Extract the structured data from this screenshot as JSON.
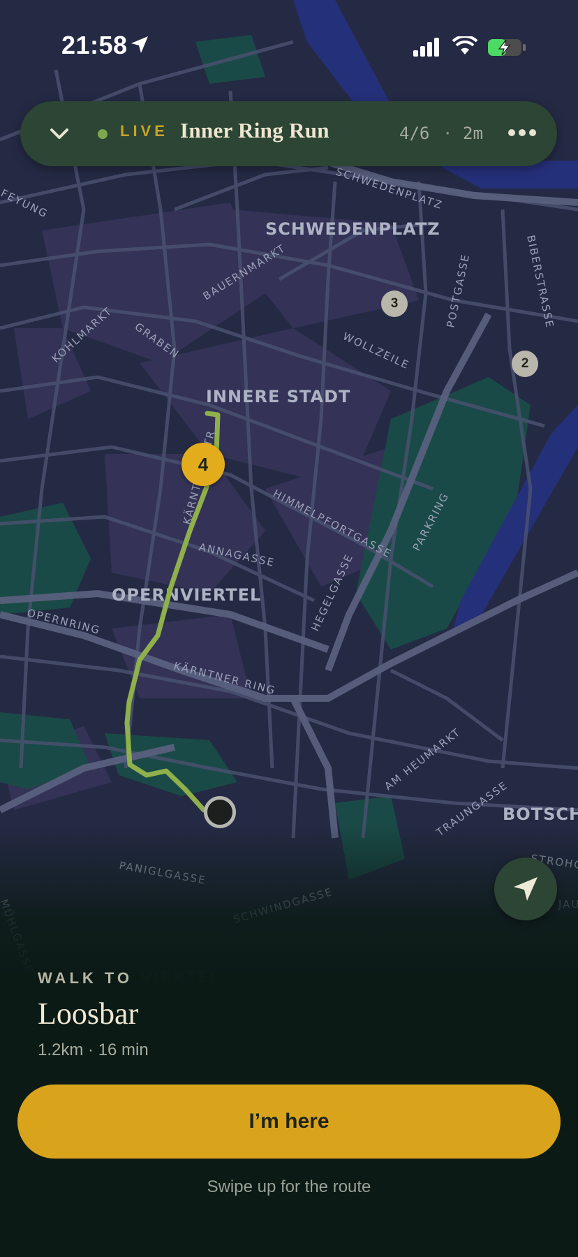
{
  "status_bar": {
    "time": "21:58",
    "icons": [
      "location-arrow-icon",
      "signal-icon",
      "wifi-icon",
      "battery-charging-icon"
    ]
  },
  "top_bar": {
    "collapse_icon": "chevron-down-icon",
    "live_label": "LIVE",
    "title": "Inner Ring Run",
    "progress": "4/6",
    "separator": "·",
    "elapsed": "2m",
    "more_icon": "more-dots-icon"
  },
  "map": {
    "districts": [
      "SCHWEDENPLATZ",
      "INNERE STADT",
      "OPERNVIERTEL",
      "BOTSCHA",
      "VIERTEL"
    ],
    "streets": [
      "SCHWEDENPLATZ",
      "BAUERNMARKT",
      "KOHLMARKT",
      "GRABEN",
      "WOLLZEILE",
      "POSTGASSE",
      "BIBERSTRASSE",
      "KÄRNTNER STRASSE",
      "HIMMELPFORTGASSE",
      "ANNAGASSE",
      "HEGELGASSE",
      "PARKRING",
      "OPERNRING",
      "KÄRNTNER RING",
      "AM HEUMARKT",
      "TRAUNGASSE",
      "PANIGLGASSE",
      "SCHWINDGASSE",
      "MÜHLGASSE",
      "FEYUNG",
      "STROHGASSE",
      "JAU"
    ],
    "stop_markers": [
      {
        "label": "4",
        "state": "current"
      },
      {
        "label": "3",
        "state": "done"
      },
      {
        "label": "2",
        "state": "done"
      }
    ],
    "colors": {
      "route": "#8fb04a",
      "current_stop": "#e2ac1c",
      "park": "#1a4a47",
      "water": "#25307a"
    },
    "locate_icon": "navigation-arrow-icon"
  },
  "sheet": {
    "eyebrow": "WALK TO",
    "destination": "Loosbar",
    "meta": "1.2km · 16 min",
    "primary_button": "I’m here",
    "hint": "Swipe up for the route"
  },
  "colors": {
    "accent": "#d9a41c",
    "pill_bg": "#2c4534",
    "sheet_bg": "#0b1a15",
    "live_dot": "#7fa84e"
  }
}
